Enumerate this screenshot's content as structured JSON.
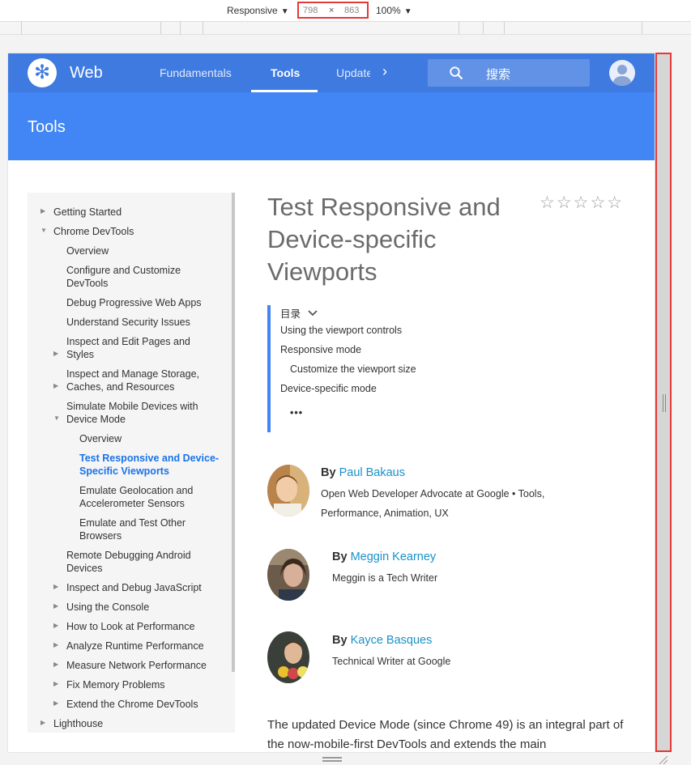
{
  "devtools": {
    "mode_label": "Responsive",
    "width_value": "798",
    "times": "×",
    "height_value": "863",
    "zoom_label": "100%"
  },
  "header": {
    "brand": "Web",
    "tabs": [
      "Fundamentals",
      "Tools",
      "Updates"
    ],
    "active_tab": "Tools",
    "search_placeholder": "搜索"
  },
  "banner": {
    "title": "Tools"
  },
  "sidebar": {
    "items": [
      "Getting Started",
      "Chrome DevTools",
      "Overview",
      "Configure and Customize DevTools",
      "Debug Progressive Web Apps",
      "Understand Security Issues",
      "Inspect and Edit Pages and Styles",
      "Inspect and Manage Storage, Caches, and Resources",
      "Simulate Mobile Devices with Device Mode",
      "Overview",
      "Test Responsive and Device-Specific Viewports",
      "Emulate Geolocation and Accelerometer Sensors",
      "Emulate and Test Other Browsers",
      "Remote Debugging Android Devices",
      "Inspect and Debug JavaScript",
      "Using the Console",
      "How to Look at Performance",
      "Analyze Runtime Performance",
      "Measure Network Performance",
      "Fix Memory Problems",
      "Extend the Chrome DevTools",
      "Lighthouse"
    ]
  },
  "article": {
    "title": "Test Responsive and Device-specific Viewports",
    "rating_stars": "☆☆☆☆☆",
    "toc": {
      "label": "目录",
      "items": [
        "Using the viewport controls",
        "Responsive mode",
        "Customize the viewport size",
        "Device-specific mode"
      ],
      "more": "•••"
    },
    "by_label": "By",
    "authors": [
      {
        "name": "Paul Bakaus",
        "bio": "Open Web Developer Advocate at Google • Tools, Performance, Animation, UX"
      },
      {
        "name": "Meggin Kearney",
        "bio": "Meggin is a Tech Writer"
      },
      {
        "name": "Kayce Basques",
        "bio": "Technical Writer at Google"
      }
    ],
    "intro": "The updated Device Mode (since Chrome 49) is an integral part of the now-mobile-first DevTools and extends the main"
  }
}
